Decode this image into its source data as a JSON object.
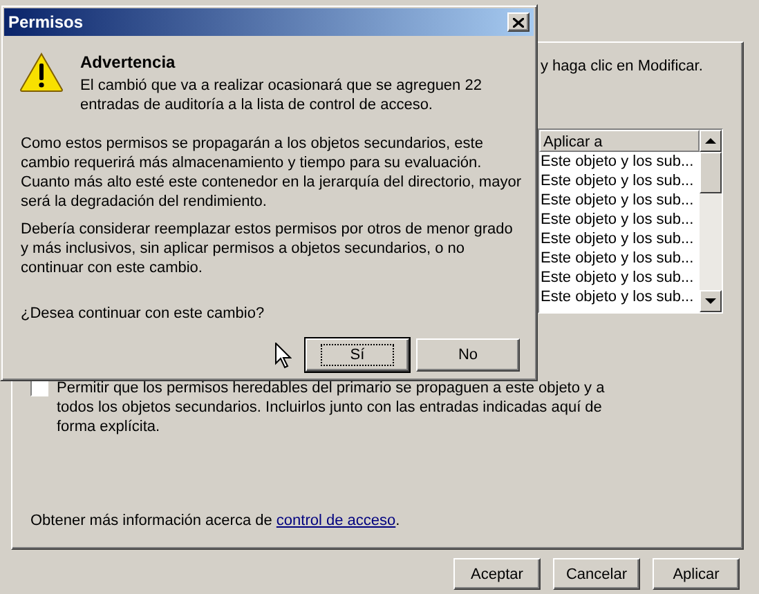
{
  "background_window": {
    "instruction": "y haga clic en Modificar.",
    "entries_list": {
      "columns": [
        "Aplicar a"
      ],
      "rows": [
        "Este objeto y los sub...",
        "Este objeto y los sub...",
        "Este objeto y los sub...",
        "Este objeto y los sub...",
        "Este objeto y los sub...",
        "Este objeto y los sub...",
        "Este objeto y los sub...",
        "Este objeto y los sub..."
      ]
    },
    "inherit_checkbox": {
      "label": "Permitir que los permisos heredables del primario se propaguen a este objeto y a todos los objetos secundarios. Incluirlos junto con las entradas indicadas aquí de forma explícita.",
      "checked": false
    },
    "help_text": {
      "prefix": "Obtener más información acerca de ",
      "link": "control de acceso",
      "suffix": "."
    },
    "buttons": [
      "Aceptar",
      "Cancelar",
      "Aplicar"
    ]
  },
  "dialog": {
    "title": "Permisos",
    "heading": "Advertencia",
    "message": "El cambió que va a realizar ocasionará que se agreguen 22 entradas de auditoría a la lista de control de acceso.",
    "paragraphs": [
      "Como estos permisos se propagarán a los objetos secundarios, este cambio requerirá más almacenamiento y tiempo para su evaluación. Cuanto más alto esté este contenedor en la jerarquía del directorio, mayor será la degradación del rendimiento.",
      "Debería considerar reemplazar estos permisos por otros de menor grado y más inclusivos, sin aplicar permisos a objetos secundarios, o no continuar con este cambio."
    ],
    "question": "¿Desea continuar con este cambio?",
    "buttons": [
      {
        "label": "Sí",
        "default": true
      },
      {
        "label": "No",
        "default": false
      }
    ]
  }
}
